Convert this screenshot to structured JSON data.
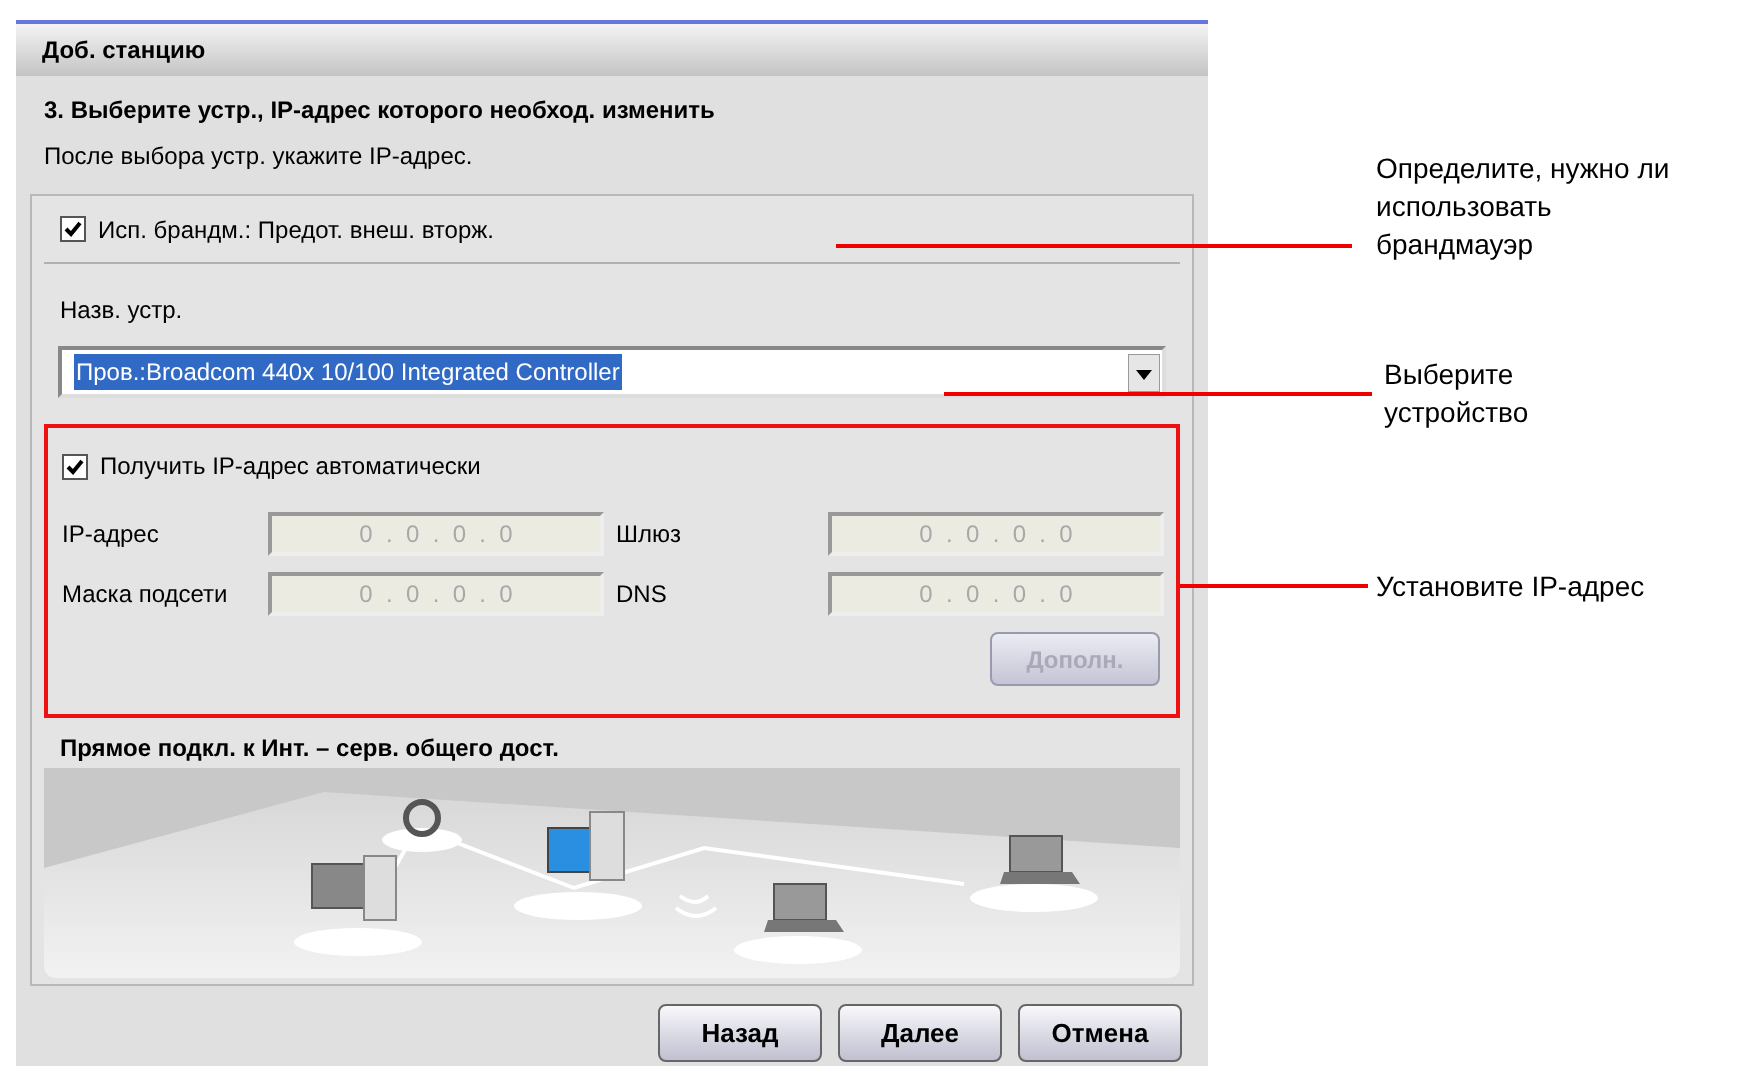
{
  "dialog": {
    "title": "Доб. станцию",
    "heading": "3. Выберите устр., IP-адрес которого необход. изменить",
    "subtitle": "После выбора устр. укажите IP-адрес."
  },
  "firewall": {
    "label": "Исп. брандм.: Предот. внеш. вторж.",
    "checked": true
  },
  "device": {
    "label": "Назв. устр.",
    "value": "Пров.:Broadcom 440x 10/100 Integrated Controller"
  },
  "auto_ip": {
    "label": "Получить IP-адрес автоматически",
    "checked": true
  },
  "ip_fields": [
    {
      "label": "IP-адрес",
      "value": "0  .  0  .  0  .  0",
      "disabled": true
    },
    {
      "label": "Шлюз",
      "value": "0  .  0  .  0  .  0",
      "disabled": true
    },
    {
      "label": "Маска подсети",
      "value": "0  .  0  .  0  .  0",
      "disabled": true
    },
    {
      "label": "DNS",
      "value": "0  .  0  .  0  .  0",
      "disabled": true
    }
  ],
  "advanced_button": {
    "label": "Дополн.",
    "disabled": true
  },
  "network_caption": "Прямое подкл. к Инт. – серв. общего дост.",
  "buttons": [
    "Назад",
    "Далее",
    "Отмена"
  ],
  "annotations": [
    {
      "text": "Определите, нужно ли использовать брандмауэр"
    },
    {
      "text": "Выберите устройство"
    },
    {
      "text": "Установите IP-адрес"
    }
  ]
}
